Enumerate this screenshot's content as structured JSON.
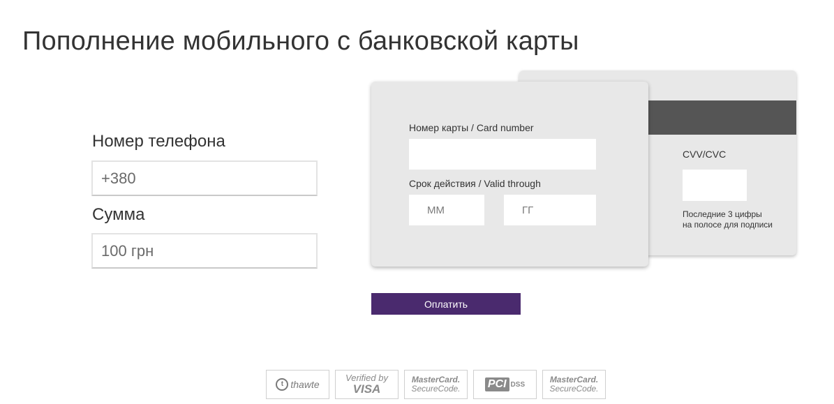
{
  "page": {
    "title": "Пополнение мобильного с банковской карты"
  },
  "phone": {
    "label": "Номер телефона",
    "placeholder": "+380"
  },
  "amount": {
    "label": "Сумма",
    "placeholder": "100 грн"
  },
  "card_front": {
    "card_number_label": "Номер карты / Card number",
    "card_number_value": "",
    "valid_through_label": "Срок действия / Valid through",
    "month_placeholder": "ММ",
    "year_placeholder": "ГГ"
  },
  "card_back": {
    "cvv_label": "CVV/CVC",
    "cvv_value": "",
    "cvv_hint_line1": "Последние 3 цифры",
    "cvv_hint_line2": "на полосе для подписи"
  },
  "pay_button": {
    "label": "Оплатить"
  },
  "badges": {
    "thawte": "thawte",
    "thawte_mark": "t",
    "vbv_line1": "Verified by",
    "vbv_line2": "VISA",
    "msc1_line1": "MasterCard.",
    "msc1_line2": "SecureCode.",
    "pci_mark": "PCI",
    "pci_dss": "DSS",
    "msc2_line1": "MasterCard.",
    "msc2_line2": "SecureCode."
  },
  "colors": {
    "button_bg": "#4a2a6e",
    "card_bg": "#e8e8e8",
    "stripe": "#555555"
  }
}
